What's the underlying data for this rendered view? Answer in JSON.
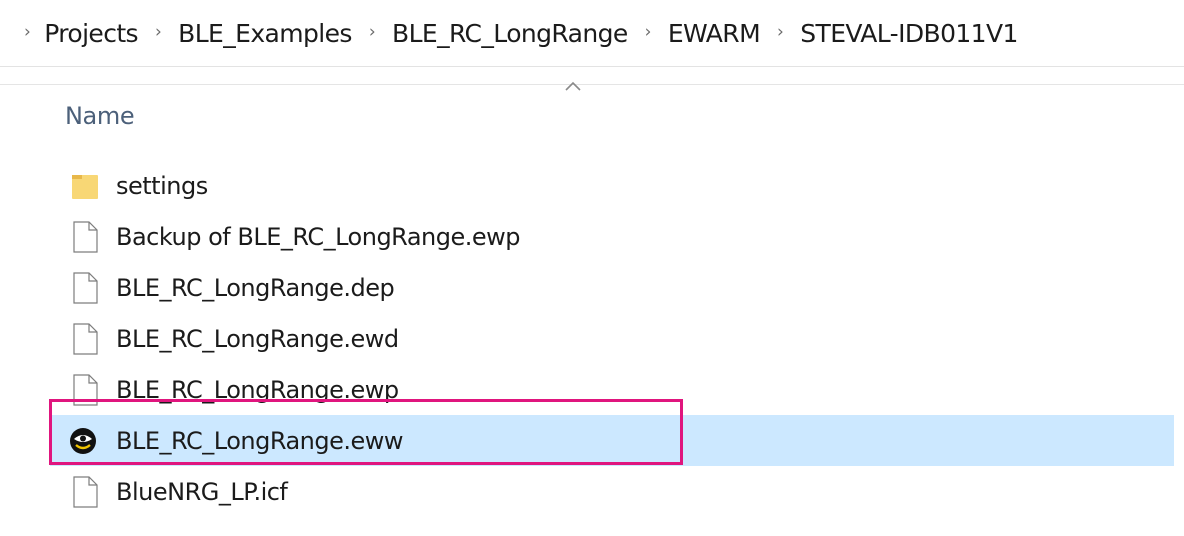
{
  "breadcrumb": {
    "separator": "›",
    "items": [
      "Projects",
      "BLE_Examples",
      "BLE_RC_LongRange",
      "EWARM",
      "STEVAL-IDB011V1"
    ]
  },
  "column": {
    "name": "Name"
  },
  "files": [
    {
      "label": "settings",
      "icon": "folder-icon"
    },
    {
      "label": "Backup of BLE_RC_LongRange.ewp",
      "icon": "file-icon"
    },
    {
      "label": "BLE_RC_LongRange.dep",
      "icon": "file-icon"
    },
    {
      "label": "BLE_RC_LongRange.ewd",
      "icon": "file-icon"
    },
    {
      "label": "BLE_RC_LongRange.ewp",
      "icon": "file-icon"
    },
    {
      "label": "BLE_RC_LongRange.eww",
      "icon": "iar-workspace-icon",
      "selected": true
    },
    {
      "label": "BlueNRG_LP.icf",
      "icon": "file-icon"
    }
  ],
  "colors": {
    "selection": "#cce8ff",
    "highlight_box": "#e0157e",
    "folder": "#f8d775"
  }
}
